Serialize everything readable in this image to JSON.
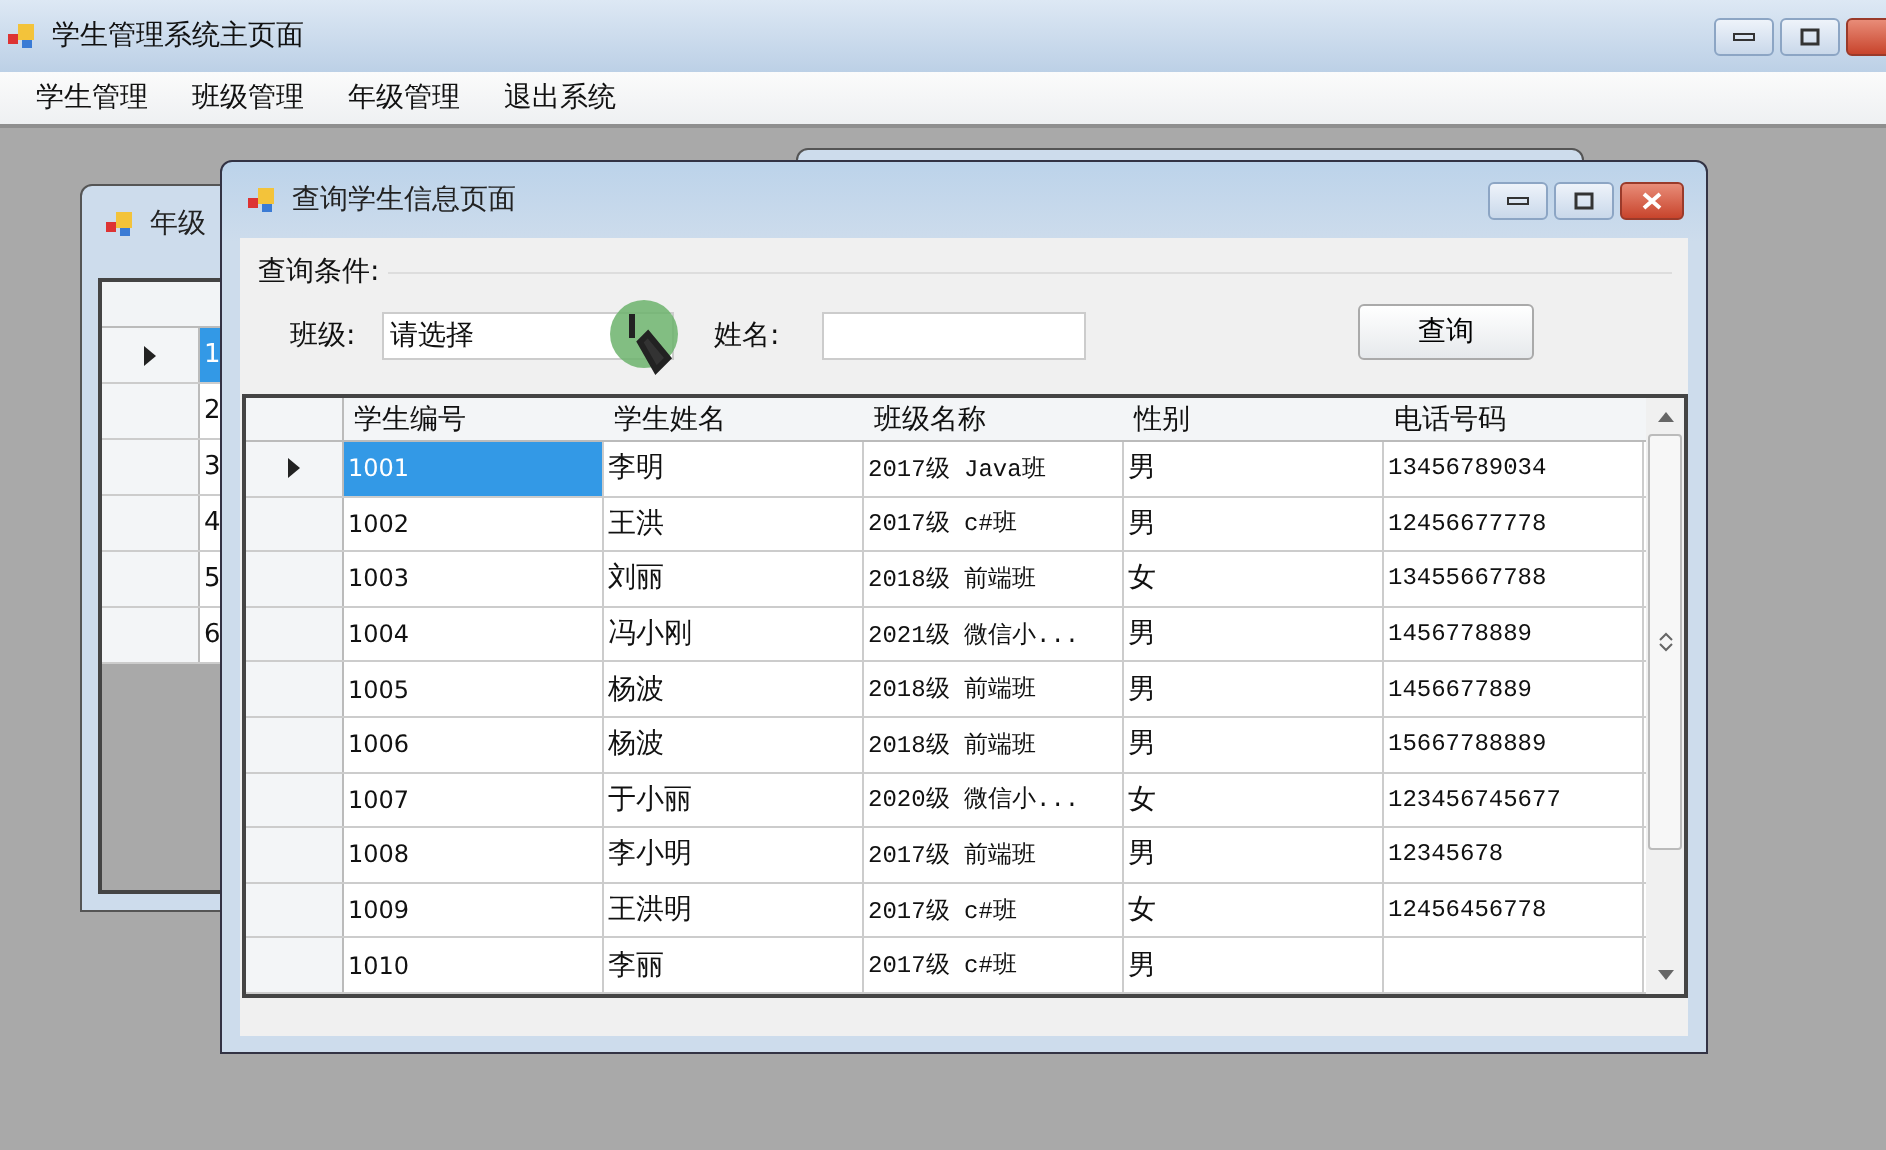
{
  "main_window": {
    "title": "学生管理系统主页面"
  },
  "menu": [
    "学生管理",
    "班级管理",
    "年级管理",
    "退出系统"
  ],
  "background_window": {
    "title": "年级",
    "rows": [
      {
        "cell": "1",
        "selected": true
      },
      {
        "cell": "2",
        "selected": false
      },
      {
        "cell": "3",
        "selected": false
      },
      {
        "cell": "4",
        "selected": false
      },
      {
        "cell": "5",
        "selected": false
      },
      {
        "cell": "6",
        "selected": false
      }
    ]
  },
  "dialog": {
    "title": "查询学生信息页面",
    "group_label": "查询条件:",
    "class_label": "班级:",
    "class_combo": {
      "value": "请选择"
    },
    "name_label": "姓名:",
    "query_button": "查询"
  },
  "table": {
    "columns": [
      "学生编号",
      "学生姓名",
      "班级名称",
      "性别",
      "电话号码"
    ],
    "rows": [
      {
        "cells": [
          "1001",
          "李明",
          "2017级 Java班",
          "男",
          "13456789034"
        ],
        "selected": true
      },
      {
        "cells": [
          "1002",
          "王洪",
          "2017级 c#班",
          "男",
          "12456677778"
        ],
        "selected": false
      },
      {
        "cells": [
          "1003",
          "刘丽",
          "2018级 前端班",
          "女",
          "13455667788"
        ],
        "selected": false
      },
      {
        "cells": [
          "1004",
          "冯小刚",
          "2021级 微信小...",
          "男",
          "1456778889"
        ],
        "selected": false
      },
      {
        "cells": [
          "1005",
          "杨波",
          "2018级 前端班",
          "男",
          "1456677889"
        ],
        "selected": false
      },
      {
        "cells": [
          "1006",
          "杨波",
          "2018级 前端班",
          "男",
          "15667788889"
        ],
        "selected": false
      },
      {
        "cells": [
          "1007",
          "于小丽",
          "2020级 微信小...",
          "女",
          "123456745677"
        ],
        "selected": false
      },
      {
        "cells": [
          "1008",
          "李小明",
          "2017级 前端班",
          "男",
          "12345678"
        ],
        "selected": false
      },
      {
        "cells": [
          "1009",
          "王洪明",
          "2017级 c#班",
          "女",
          "12456456778"
        ],
        "selected": false
      },
      {
        "cells": [
          "1010",
          "李丽",
          "2017级 c#班",
          "男",
          ""
        ],
        "selected": false
      }
    ]
  }
}
